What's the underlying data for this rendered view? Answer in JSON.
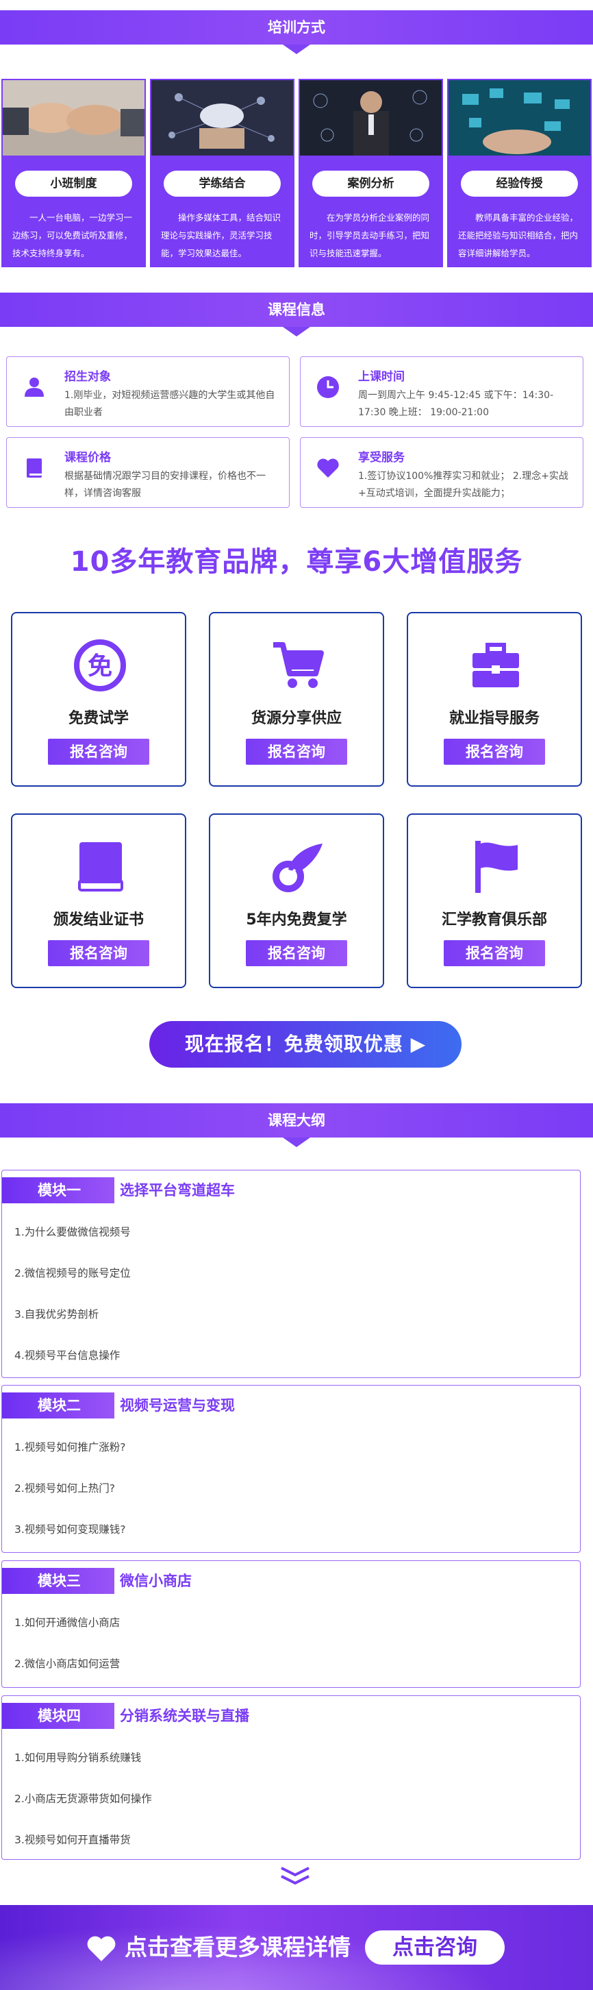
{
  "training": {
    "header": "培训方式",
    "cards": [
      {
        "title": "小班制度",
        "desc": "一人一台电脑，一边学习一边练习，可以免费试听及重修，技术支持终身享有。"
      },
      {
        "title": "学练结合",
        "desc": "操作多媒体工具，结合知识理论与实践操作，灵活学习技能，学习效果达最佳。"
      },
      {
        "title": "案例分析",
        "desc": "在为学员分析企业案例的同时，引导学员去动手练习，把知识与技能迅速掌握。"
      },
      {
        "title": "经验传授",
        "desc": "教师具备丰富的企业经验，还能把经验与知识相结合，把内容详细讲解给学员。"
      }
    ]
  },
  "course_info": {
    "header": "课程信息",
    "cards": [
      {
        "title": "招生对象",
        "text": "1.刚毕业，对短视频运营感兴趣的大学生或其他自由职业者"
      },
      {
        "title": "上课时间",
        "text": "周一到周六上午 9:45-12:45 或下午：14:30-17:30 晚上班： 19:00-21:00"
      },
      {
        "title": "课程价格",
        "text": "根据基础情况跟学习目的安排课程，价格也不一样，详情咨询客服"
      },
      {
        "title": "享受服务",
        "text": "1.签订协议100%推荐实习和就业；  2.理念+实战+互动式培训，全面提升实战能力；"
      }
    ]
  },
  "slogan": "10多年教育品牌，尊享6大增值服务",
  "services": {
    "button_label": "报名咨询",
    "items": [
      {
        "name": "免费试学",
        "icon": "free-icon",
        "badge": "免"
      },
      {
        "name": "货源分享供应",
        "icon": "cart-icon"
      },
      {
        "name": "就业指导服务",
        "icon": "briefcase-icon"
      },
      {
        "name": "颁发结业证书",
        "icon": "book-icon"
      },
      {
        "name": "5年内免费复学",
        "icon": "feather-icon"
      },
      {
        "name": "汇学教育俱乐部",
        "icon": "flag-icon"
      }
    ]
  },
  "cta": "现在报名！免费领取优惠 ▶",
  "outline": {
    "header": "课程大纲",
    "modules": [
      {
        "tag": "模块一",
        "title": "选择平台弯道超车",
        "items": [
          "1.为什么要做微信视频号",
          "2.微信视频号的账号定位",
          "3.自我优劣势剖析",
          "4.视频号平台信息操作"
        ]
      },
      {
        "tag": "模块二",
        "title": "视频号运营与变现",
        "items": [
          "1.视频号如何推广涨粉?",
          "2.视频号如何上热门?",
          "3.视频号如何变现赚钱?"
        ]
      },
      {
        "tag": "模块三",
        "title": "微信小商店",
        "items": [
          "1.如何开通微信小商店",
          "2.微信小商店如何运营"
        ]
      },
      {
        "tag": "模块四",
        "title": "分销系统关联与直播",
        "items": [
          "1.如何用导购分销系统赚钱",
          "2.小商店无货源带货如何操作",
          "3.视频号如何开直播带货"
        ]
      }
    ]
  },
  "footer": {
    "text": "点击查看更多课程详情",
    "button": "点击咨询"
  },
  "colors": {
    "primary": "#7a3cf5",
    "service_border": "#1a3aa8"
  }
}
